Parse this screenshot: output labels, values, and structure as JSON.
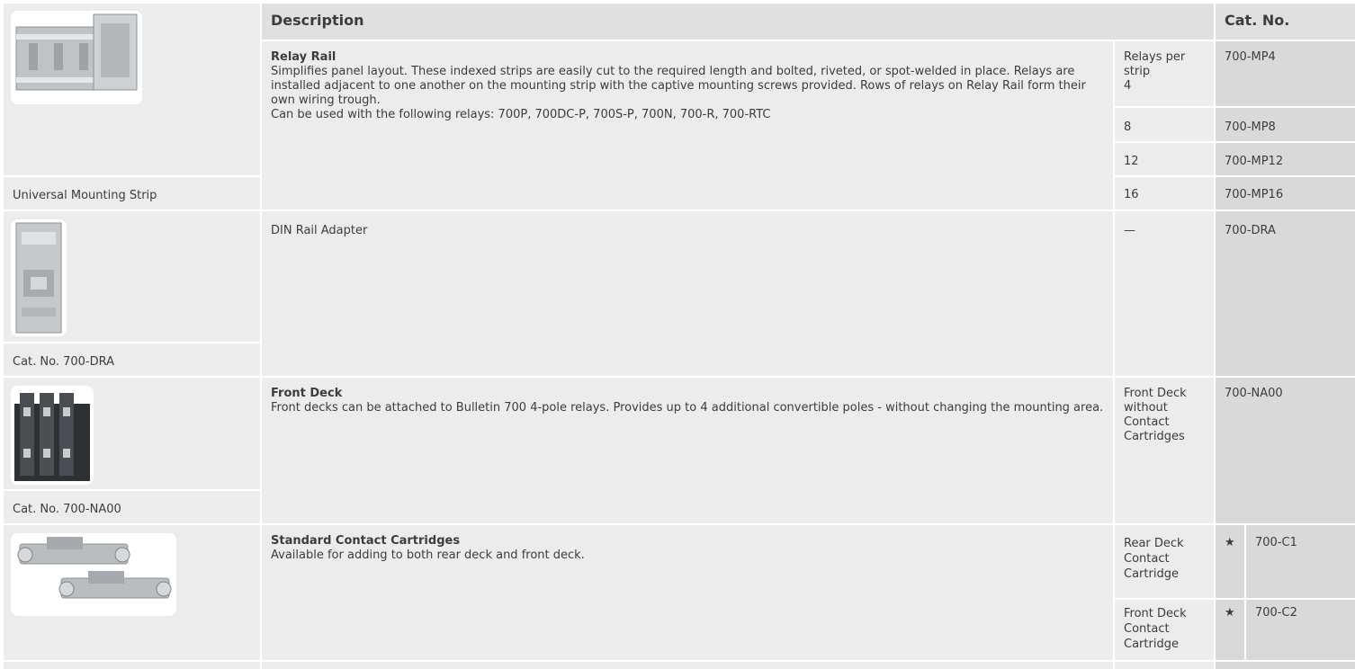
{
  "header": {
    "description": "Description",
    "cat_no": "Cat. No."
  },
  "rows": [
    {
      "image_caption": "Universal Mounting Strip",
      "title": "Relay Rail",
      "description": "Simplifies panel layout. These indexed strips are easily cut to the required length and bolted, riveted, or spot-welded in place. Relays are installed adjacent to one another on the mounting strip with the captive mounting screws provided. Rows of relays on Relay Rail form their own wiring trough.",
      "note": "Can be used with the following relays: 700P, 700DC-P, 700S-P, 700N, 700-R, 700-RTC",
      "options": [
        {
          "label": "Relays per strip",
          "value": "4",
          "cat": "700-MP4"
        },
        {
          "value": "8",
          "cat": "700-MP8"
        },
        {
          "value": "12",
          "cat": "700-MP12"
        },
        {
          "value": "16",
          "cat": "700-MP16"
        }
      ]
    },
    {
      "image_caption": "Cat. No. 700-DRA",
      "description": "DIN Rail Adapter",
      "option": "—",
      "cat": "700-DRA"
    },
    {
      "image_caption": "Cat. No. 700-NA00",
      "title": "Front Deck",
      "description": "Front decks can be attached to Bulletin 700 4-pole relays. Provides up to 4 additional convertible poles - without changing the mounting area.",
      "option": "Front Deck without Contact Cartridges",
      "cat": "700-NA00"
    },
    {
      "title": "Standard Contact Cartridges",
      "description": "Available for adding to both rear deck and front deck.",
      "options": [
        {
          "label": "Rear Deck Contact Cartridge",
          "marker": "★",
          "cat": "700-C1"
        },
        {
          "label": "Front Deck Contact Cartridge",
          "marker": "★",
          "cat": "700-C2"
        }
      ]
    }
  ]
}
